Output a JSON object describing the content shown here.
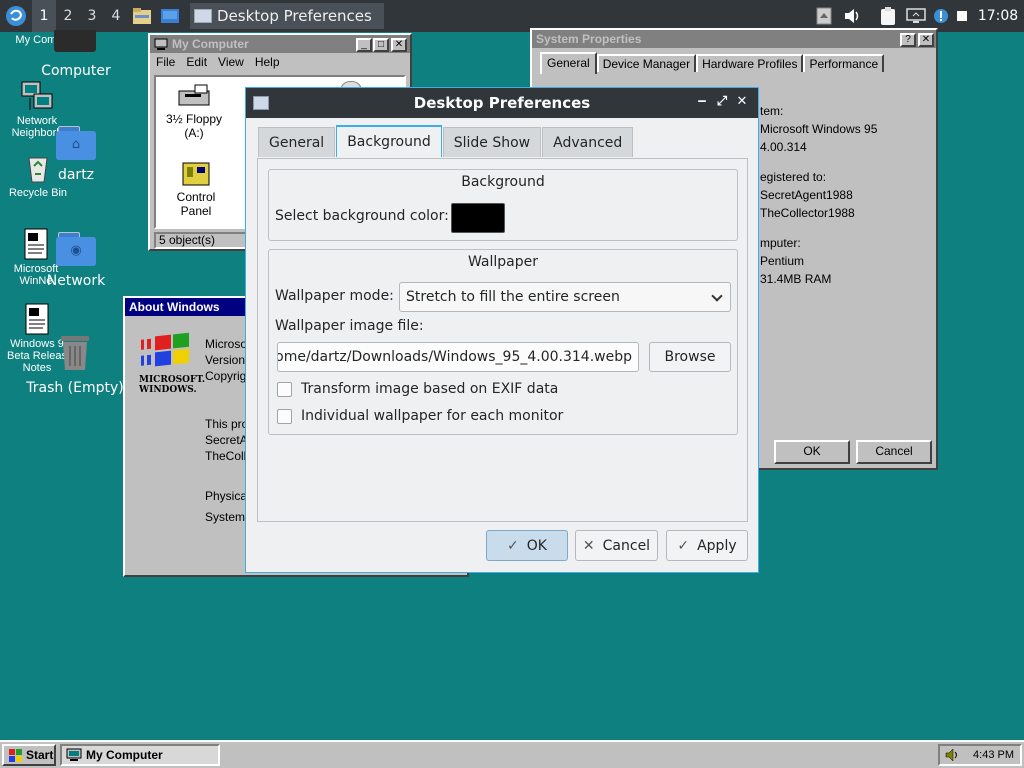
{
  "top_panel": {
    "desktops": [
      "1",
      "2",
      "3",
      "4"
    ],
    "active_desktop": "1",
    "task_title": "Desktop Preferences",
    "clock": "17:08"
  },
  "desktop_icons": {
    "my_computer_small": "My Compu",
    "computer": "Computer",
    "network_neighborhood": "Network Neighborh",
    "dartz": "dartz",
    "recycle_bin": "Recycle Bin",
    "network": "Network",
    "winnews_line1": "Microsoft",
    "winnews_line2": "WinNe",
    "beta_notes": "Windows 9 Beta Releas Notes",
    "trash": "Trash (Empty)"
  },
  "my_computer_window": {
    "title": "My Computer",
    "menu": [
      "File",
      "Edit",
      "View",
      "Help"
    ],
    "items": [
      "3½ Floppy (A:)",
      "Control Panel"
    ],
    "status": "5 object(s)"
  },
  "about_window": {
    "title": "About Windows",
    "logo_text": "MICROSOFT. WINDOWS.",
    "lines": [
      "Microsof",
      "Version 4",
      "Copyrigh",
      "This prod",
      "SecretAg",
      "TheColle",
      "Physical",
      "System R"
    ]
  },
  "system_properties": {
    "title": "System Properties",
    "tabs": [
      "General",
      "Device Manager",
      "Hardware Profiles",
      "Performance"
    ],
    "lines": [
      "tem:",
      "Microsoft Windows 95",
      "4.00.314",
      "egistered to:",
      "SecretAgent1988",
      "TheCollector1988",
      "mputer:",
      "Pentium",
      "31.4MB RAM"
    ],
    "ok": "OK",
    "cancel": "Cancel"
  },
  "prefs": {
    "title": "Desktop Preferences",
    "tabs": [
      "General",
      "Background",
      "Slide Show",
      "Advanced"
    ],
    "active_tab": "Background",
    "background_group": "Background",
    "bg_color_label": "Select background color:",
    "bg_color": "#000000",
    "wallpaper_group": "Wallpaper",
    "mode_label": "Wallpaper mode:",
    "mode_value": "Stretch to fill the entire screen",
    "file_label": "Wallpaper image file:",
    "file_value": "ome/dartz/Downloads/Windows_95_4.00.314.webp",
    "browse": "Browse",
    "exif_label": "Transform image based on EXIF data",
    "monitor_label": "Individual wallpaper for each monitor",
    "ok": "OK",
    "cancel": "Cancel",
    "apply": "Apply"
  },
  "taskbar": {
    "start": "Start",
    "task": "My Computer",
    "time": "4:43 PM"
  },
  "colors": {
    "desktop": "#0f8080",
    "accent": "#3daee9",
    "win95_title": "#000080"
  }
}
